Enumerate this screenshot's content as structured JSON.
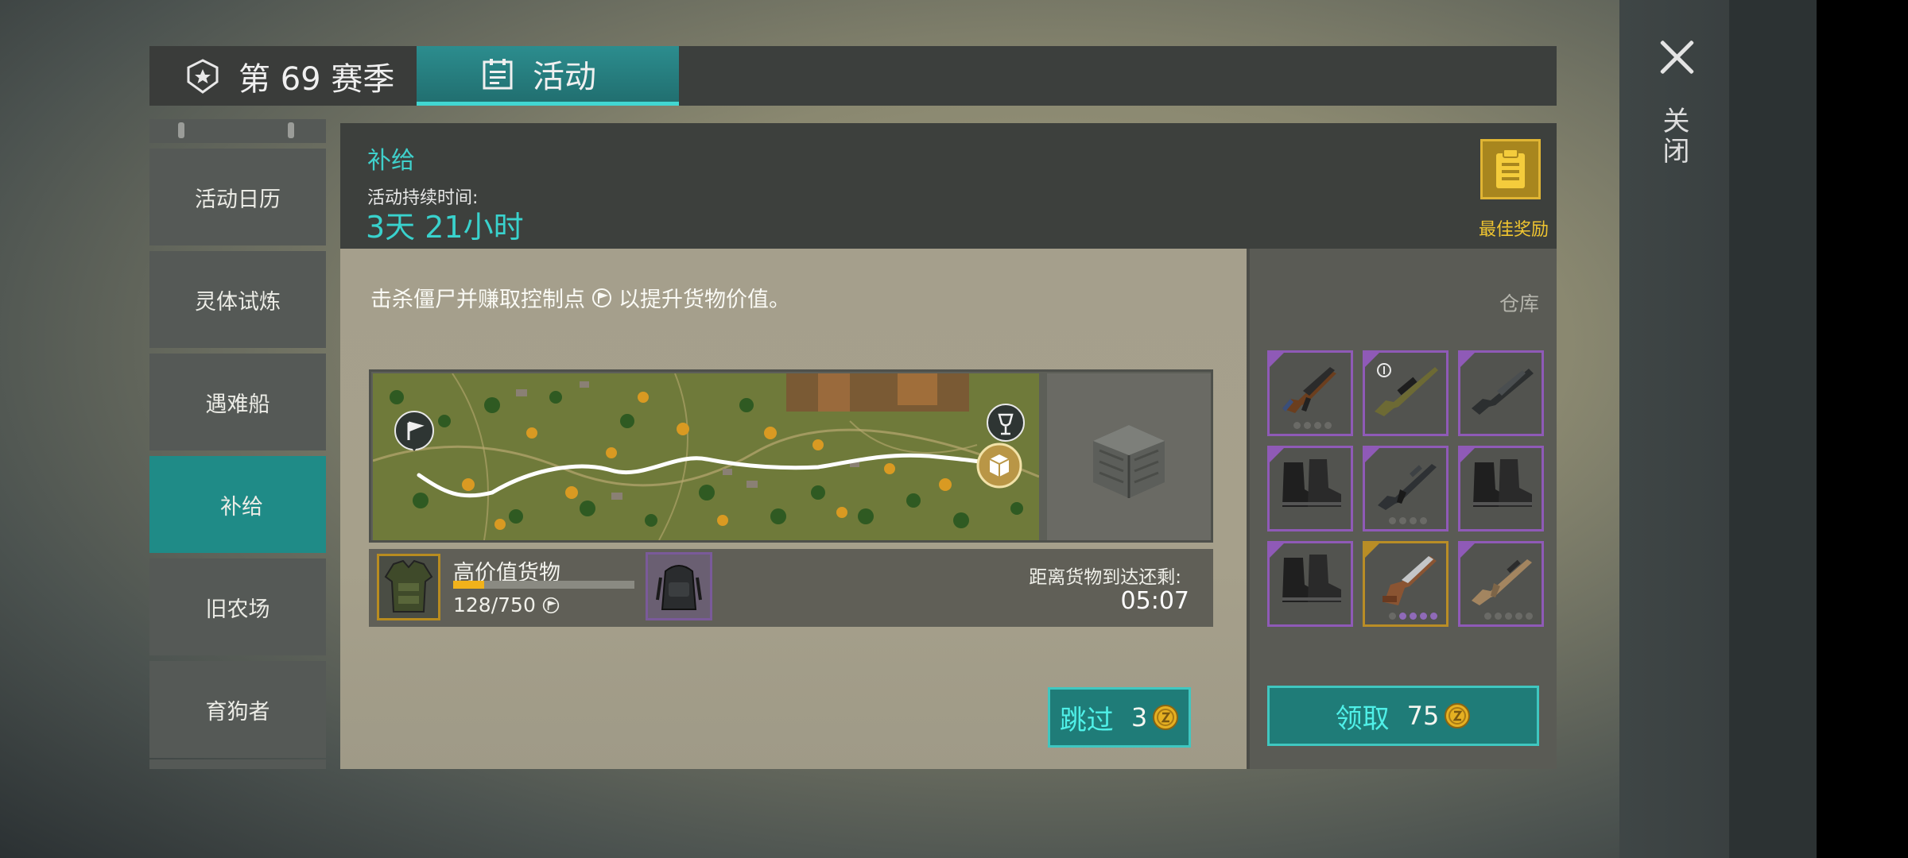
{
  "tabs": {
    "season_label": "第 69 赛季",
    "activity_label": "活动"
  },
  "close": {
    "label": "关闭"
  },
  "sidebar": {
    "items": [
      {
        "label": "活动日历"
      },
      {
        "label": "灵体试炼"
      },
      {
        "label": "遇难船"
      },
      {
        "label": "补给"
      },
      {
        "label": "旧农场"
      },
      {
        "label": "育狗者"
      }
    ],
    "active_index": 3
  },
  "event": {
    "title": "补给",
    "duration_label": "活动持续时间:",
    "duration_value": "3天 21小时",
    "best_reward_label": "最佳奖励",
    "description_before": "击杀僵尸并赚取控制点",
    "description_after": " 以提升货物价值。"
  },
  "cargo": {
    "name": "高价值货物",
    "progress_text": "128/750",
    "progress_value": 128,
    "progress_max": 750,
    "arrival_label": "距离货物到达还剩:",
    "arrival_time": "05:07"
  },
  "skip": {
    "label": "跳过",
    "cost": "3"
  },
  "storage": {
    "label": "仓库",
    "items": [
      {
        "name": "ak-rifle",
        "rarity": "purple",
        "dots": 4,
        "active_dots": 0
      },
      {
        "name": "sniper-rifle",
        "rarity": "purple",
        "dots": 0,
        "active_dots": 0
      },
      {
        "name": "shotgun",
        "rarity": "purple",
        "dots": 0,
        "active_dots": 0
      },
      {
        "name": "combat-boots",
        "rarity": "purple",
        "dots": 0,
        "active_dots": 0
      },
      {
        "name": "assault-rifle",
        "rarity": "purple",
        "dots": 4,
        "active_dots": 0
      },
      {
        "name": "combat-boots",
        "rarity": "purple",
        "dots": 0,
        "active_dots": 0
      },
      {
        "name": "combat-boots",
        "rarity": "purple",
        "dots": 0,
        "active_dots": 0
      },
      {
        "name": "pistol",
        "rarity": "gold",
        "dots": 5,
        "active_dots": 4
      },
      {
        "name": "scar-rifle",
        "rarity": "purple",
        "dots": 5,
        "active_dots": 0
      }
    ]
  },
  "claim": {
    "label": "领取",
    "cost": "75"
  },
  "colors": {
    "accent_teal": "#1f8b87",
    "title_teal": "#3fd0cb",
    "gold": "#f0c530",
    "rarity_purple": "#8f5ab7",
    "rarity_gold": "#b98d26",
    "progress_fill": "#f1b21b"
  }
}
